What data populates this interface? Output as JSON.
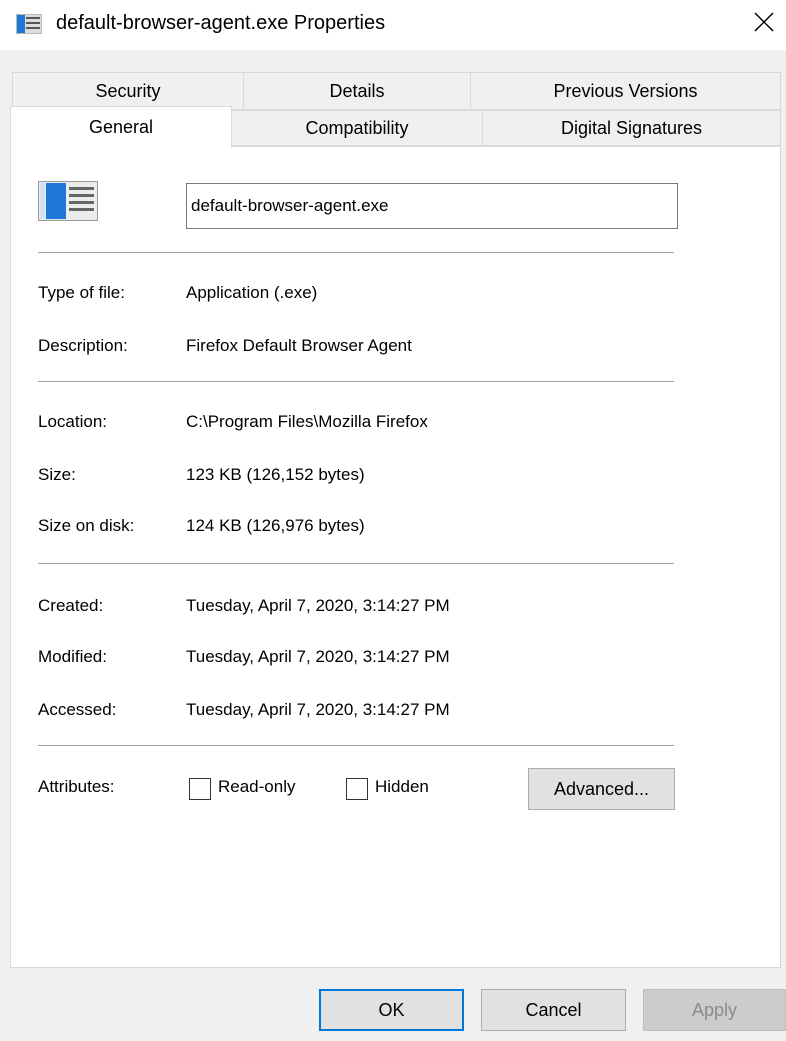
{
  "window": {
    "title": "default-browser-agent.exe Properties",
    "close_icon": "close-icon",
    "app_icon": "application-icon"
  },
  "tabs": {
    "row_back": [
      "Security",
      "Details",
      "Previous Versions"
    ],
    "row_front": [
      "General",
      "Compatibility",
      "Digital Signatures"
    ],
    "selected": "General"
  },
  "general": {
    "file_name": "default-browser-agent.exe",
    "type_label": "Type of file:",
    "type_value": "Application (.exe)",
    "desc_label": "Description:",
    "desc_value": "Firefox Default Browser Agent",
    "location_label": "Location:",
    "location_value": "C:\\Program Files\\Mozilla Firefox",
    "size_label": "Size:",
    "size_value": "123 KB (126,152 bytes)",
    "disk_label": "Size on disk:",
    "disk_value": "124 KB (126,976 bytes)",
    "created_label": "Created:",
    "created_value": "Tuesday, April 7, 2020, 3:14:27 PM",
    "modified_label": "Modified:",
    "modified_value": "Tuesday, April 7, 2020, 3:14:27 PM",
    "accessed_label": "Accessed:",
    "accessed_value": "Tuesday, April 7, 2020, 3:14:27 PM",
    "attributes_label": "Attributes:",
    "readonly_label": "Read-only",
    "readonly_checked": false,
    "hidden_label": "Hidden",
    "hidden_checked": false,
    "advanced_label": "Advanced..."
  },
  "buttons": {
    "ok": "OK",
    "cancel": "Cancel",
    "apply": "Apply"
  },
  "colors": {
    "accent": "#0078d7",
    "icon_blue": "#1e78d7"
  }
}
